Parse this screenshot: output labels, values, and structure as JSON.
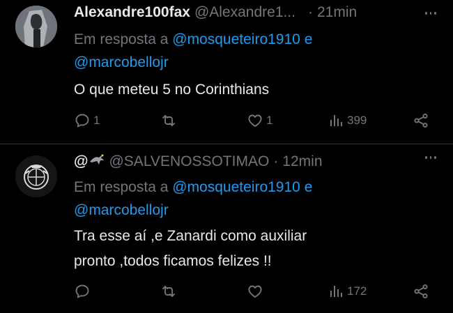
{
  "tweets": [
    {
      "name": "Alexandre100fax",
      "handle": "@Alexandre1...",
      "dot": "·",
      "time": "21min",
      "reply_prefix": "Em resposta a",
      "mention1": "@mosqueteiro1910",
      "reply_and": "e",
      "mention2": "@marcobellojr",
      "text_lines": [
        "O que meteu 5 no Corinthians"
      ],
      "actions": {
        "replies": "1",
        "retweets": "",
        "likes": "1",
        "views": "399"
      }
    },
    {
      "name": "@",
      "handle": "@SALVENOSSOTIMAO",
      "dot": "·",
      "time": "12min",
      "reply_prefix": "Em resposta a",
      "mention1": "@mosqueteiro1910",
      "reply_and": "e",
      "mention2": "@marcobellojr",
      "text_lines": [
        "Tra esse aí ,e Zanardi como auxiliar",
        "pronto ,todos ficamos felizes !!"
      ],
      "actions": {
        "replies": "",
        "retweets": "",
        "likes": "",
        "views": "172"
      }
    }
  ],
  "icons": [
    "reply-icon",
    "retweet-icon",
    "like-icon",
    "views-icon",
    "share-icon",
    "more-icon",
    "eagle-emoji-icon"
  ],
  "colors": {
    "background": "#000000",
    "text": "#e7e9ea",
    "muted": "#71767b",
    "link": "#1d9bf0",
    "divider": "#2f3336"
  }
}
